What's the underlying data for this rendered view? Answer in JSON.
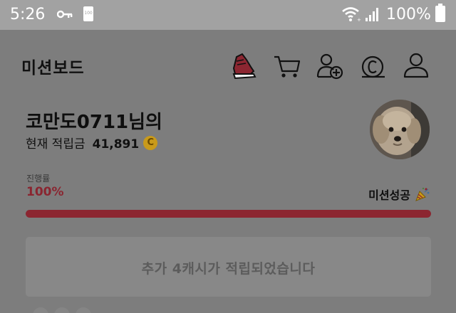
{
  "status_bar": {
    "time": "5:26",
    "battery_small_label": "100",
    "battery_percent": "100%",
    "icons": [
      "key-icon",
      "battery-icon",
      "wifi-icon",
      "signal-icon",
      "battery-icon"
    ]
  },
  "header": {
    "title": "미션보드",
    "icons": [
      "sneaker-icon",
      "cart-icon",
      "add-friend-icon",
      "cash-icon",
      "profile-icon"
    ]
  },
  "profile": {
    "greeting": "코만도0711님의",
    "points_label": "현재 적립금",
    "points_value": "41,891",
    "coin_symbol": "C"
  },
  "progress": {
    "label": "진행률",
    "value_text": "100%",
    "value": 1.0,
    "status": "미션성공"
  },
  "notice": {
    "text": "추가 4캐시가 적립되었습니다"
  },
  "colors": {
    "accent": "#8c2631",
    "coin": "#c99a1a",
    "overlay": "#7d7d7d"
  }
}
